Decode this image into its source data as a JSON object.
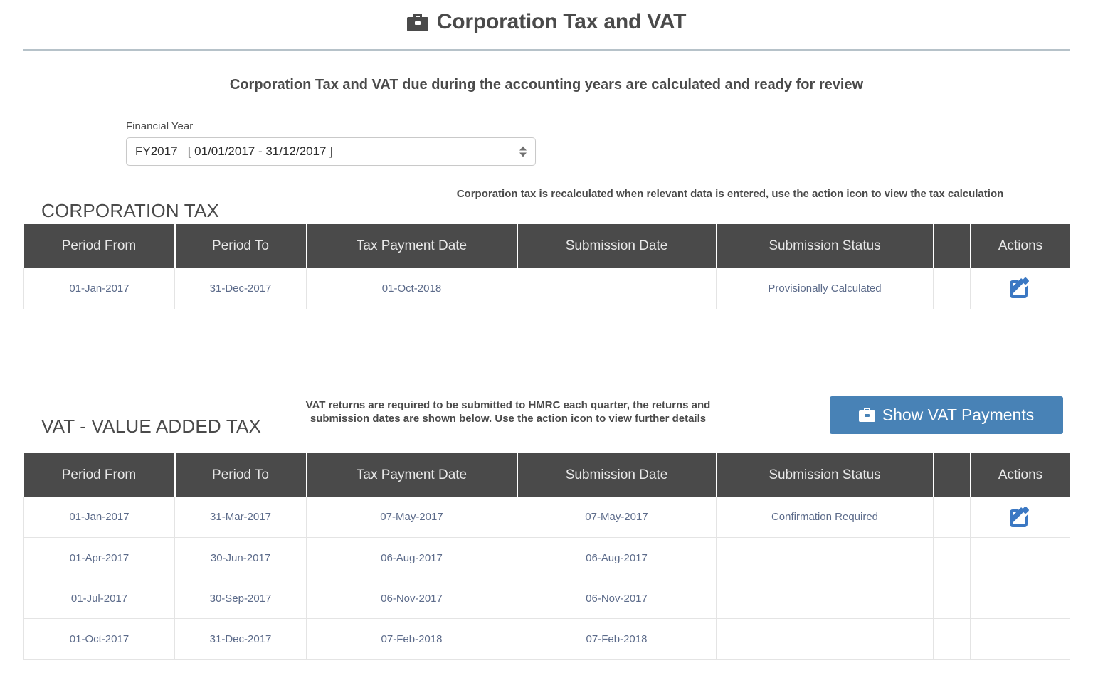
{
  "header": {
    "title": "Corporation Tax and VAT",
    "icon": "briefcase-icon"
  },
  "intro": {
    "text": "Corporation Tax and VAT due during the accounting years are calculated and ready for review"
  },
  "financial_year": {
    "label": "Financial Year",
    "selected": "FY2017   [ 01/01/2017 - 31/12/2017 ]",
    "options": [
      "FY2017   [ 01/01/2017 - 31/12/2017 ]"
    ]
  },
  "corporation_tax": {
    "section_title": "CORPORATION TAX",
    "note": "Corporation tax is recalculated when relevant data is entered, use the action icon to view the tax calculation",
    "columns": {
      "period_from": "Period From",
      "period_to": "Period To",
      "tax_payment_date": "Tax Payment Date",
      "submission_date": "Submission Date",
      "submission_status": "Submission Status",
      "spacer": "",
      "actions": "Actions"
    },
    "rows": [
      {
        "period_from": "01-Jan-2017",
        "period_to": "31-Dec-2017",
        "tax_payment_date": "01-Oct-2018",
        "submission_date": "",
        "submission_status": "Provisionally Calculated",
        "spacer": "",
        "action_icon": "edit-icon"
      }
    ]
  },
  "vat": {
    "section_title": "VAT - VALUE ADDED TAX",
    "note": "VAT returns are required to be submitted to HMRC each quarter, the returns and submission dates are shown below. Use the action icon to view further details",
    "button_label": "Show VAT Payments",
    "button_icon": "briefcase-icon",
    "columns": {
      "period_from": "Period From",
      "period_to": "Period To",
      "tax_payment_date": "Tax Payment Date",
      "submission_date": "Submission Date",
      "submission_status": "Submission Status",
      "spacer": "",
      "actions": "Actions"
    },
    "rows": [
      {
        "period_from": "01-Jan-2017",
        "period_to": "31-Mar-2017",
        "tax_payment_date": "07-May-2017",
        "submission_date": "07-May-2017",
        "submission_status": "Confirmation Required",
        "spacer": "",
        "action_icon": "edit-icon"
      },
      {
        "period_from": "01-Apr-2017",
        "period_to": "30-Jun-2017",
        "tax_payment_date": "06-Aug-2017",
        "submission_date": "06-Aug-2017",
        "submission_status": "",
        "spacer": "",
        "action_icon": ""
      },
      {
        "period_from": "01-Jul-2017",
        "period_to": "30-Sep-2017",
        "tax_payment_date": "06-Nov-2017",
        "submission_date": "06-Nov-2017",
        "submission_status": "",
        "spacer": "",
        "action_icon": ""
      },
      {
        "period_from": "01-Oct-2017",
        "period_to": "31-Dec-2017",
        "tax_payment_date": "07-Feb-2018",
        "submission_date": "07-Feb-2018",
        "submission_status": "",
        "spacer": "",
        "action_icon": ""
      }
    ]
  },
  "colors": {
    "header_bar": "#4a4a4a",
    "cell_text": "#5c6b8a",
    "accent_blue": "#3b78c3",
    "button_blue": "#4882b6",
    "rule": "#b6c2c9"
  }
}
